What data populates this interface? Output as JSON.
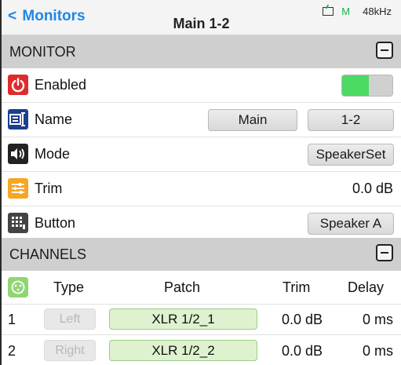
{
  "header": {
    "back_label": "Monitors",
    "title": "Main 1-2",
    "status_m": "M",
    "sample_rate": "48kHz"
  },
  "monitor_section": {
    "title": "MONITOR",
    "rows": {
      "enabled": {
        "label": "Enabled",
        "state": "on"
      },
      "name": {
        "label": "Name",
        "part1": "Main",
        "part2": "1-2"
      },
      "mode": {
        "label": "Mode",
        "value": "SpeakerSet"
      },
      "trim": {
        "label": "Trim",
        "value": "0.0 dB"
      },
      "button": {
        "label": "Button",
        "value": "Speaker A"
      }
    }
  },
  "channels_section": {
    "title": "CHANNELS",
    "columns": {
      "type": "Type",
      "patch": "Patch",
      "trim": "Trim",
      "delay": "Delay"
    },
    "rows": [
      {
        "index": "1",
        "type": "Left",
        "patch": "XLR 1/2_1",
        "trim": "0.0 dB",
        "delay": "0 ms"
      },
      {
        "index": "2",
        "type": "Right",
        "patch": "XLR 1/2_2",
        "trim": "0.0 dB",
        "delay": "0 ms"
      }
    ]
  },
  "colors": {
    "accent": "#1f86e8",
    "section_bg": "#cfcfcf",
    "toggle_on": "#4cd964",
    "power": "#e02b2b",
    "name_icon": "#1d3f8f",
    "mode_icon": "#222222",
    "trim_icon": "#f6a623",
    "button_icon": "#444444",
    "channel_icon": "#8fd672",
    "patch_bg": "#def2cf"
  }
}
